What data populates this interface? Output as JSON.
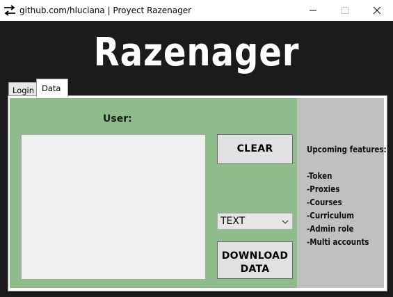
{
  "window": {
    "title": "github.com/hluciana | Proyect Razenager"
  },
  "header": {
    "brand": "Razenager"
  },
  "tabs": [
    {
      "label": "Login",
      "active": false
    },
    {
      "label": "Data",
      "active": true
    }
  ],
  "form": {
    "user_label": "User:",
    "user_value": "",
    "clear_label": "CLEAR",
    "format_value": "TEXT",
    "download_line1": "DOWNLOAD",
    "download_line2": "DATA"
  },
  "features": {
    "title": "Upcoming features:",
    "items": [
      "-Token",
      "-Proxies",
      "-Courses",
      "-Curriculum",
      "-Admin role",
      "-Multi accounts"
    ]
  },
  "colors": {
    "titlebar": "#ffffff",
    "background": "#1b1b1d",
    "panel_green": "#8fbc8b",
    "panel_gray": "#c0c0c0"
  },
  "icons": [
    "swap-arrows-icon",
    "minimize-icon",
    "maximize-icon",
    "close-icon",
    "chevron-down-icon"
  ]
}
